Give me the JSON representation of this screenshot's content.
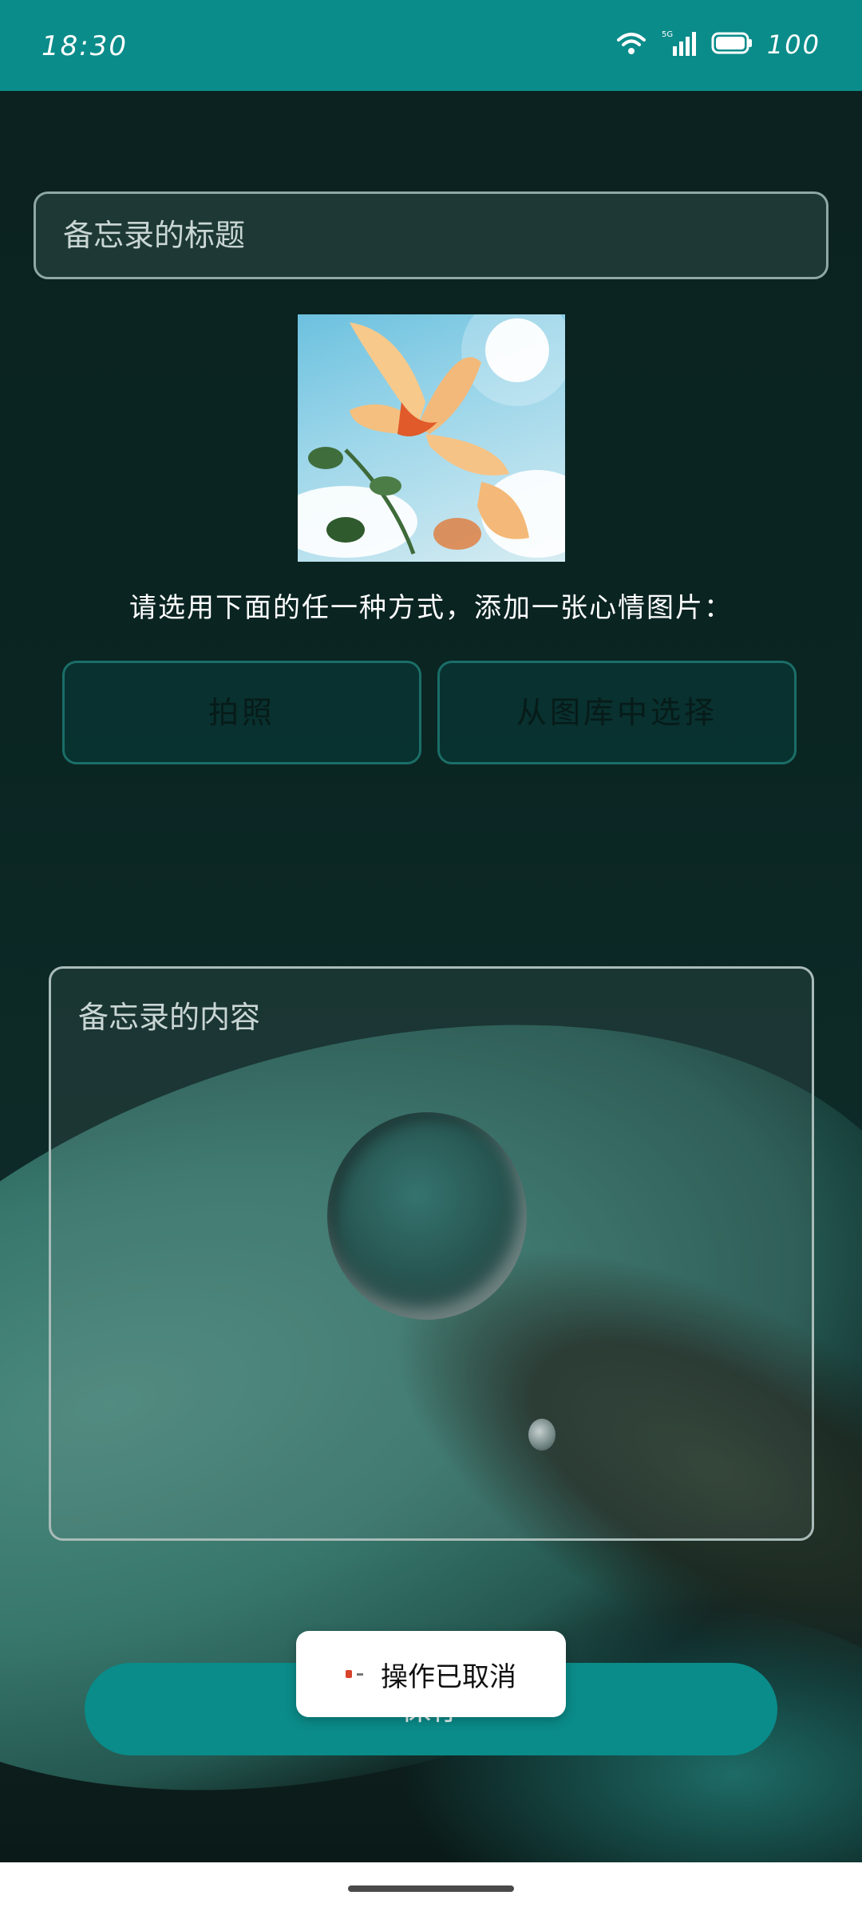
{
  "status_bar": {
    "time": "18:30",
    "battery_level": "100",
    "network_label": "5G"
  },
  "form": {
    "title_placeholder": "备忘录的标题",
    "hint": "请选用下面的任一种方式，添加一张心情图片：",
    "camera_button": "拍照",
    "gallery_button": "从图库中选择",
    "content_placeholder": "备忘录的内容",
    "save_button": "保存"
  },
  "toast": {
    "message": "操作已取消"
  },
  "colors": {
    "accent": "#0a8c8a",
    "toast_bg": "#ffffff"
  },
  "icons": [
    "wifi-icon",
    "cellular-signal-icon",
    "battery-icon",
    "toast-app-icon"
  ]
}
